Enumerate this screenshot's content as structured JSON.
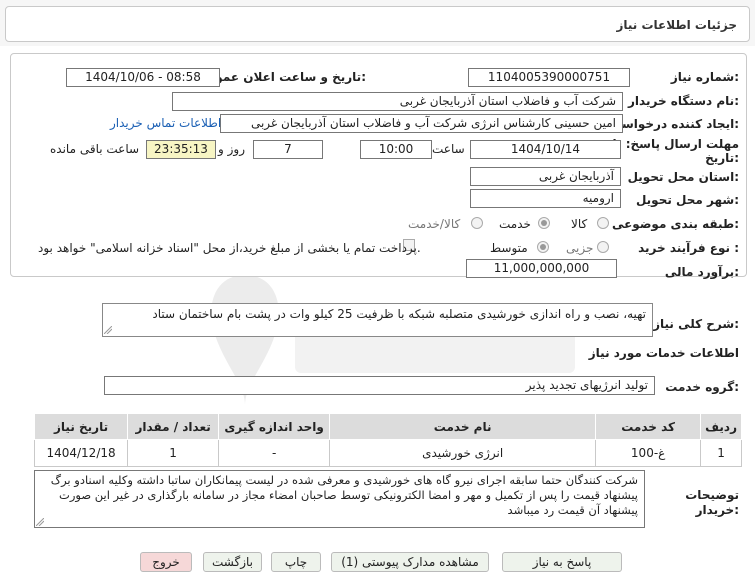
{
  "header": {
    "title": "جزئیات اطلاعات نیاز"
  },
  "form": {
    "need_number": {
      "label": "شماره نیاز:",
      "value": "1104005390000751"
    },
    "announce_datetime": {
      "label": "تاریخ و ساعت اعلان عمومی:",
      "value": "1404/10/06 - 08:58"
    },
    "buyer_org": {
      "label": "نام دستگاه خریدار:",
      "value": "شرکت آب و فاضلاب استان آذربایجان غربی"
    },
    "requester": {
      "label": "ایجاد کننده درخواست:",
      "value": "امین حسینی کارشناس انرژی شرکت آب و فاضلاب استان آذربایجان غربی"
    },
    "contact_link": "اطلاعات تماس خریدار",
    "deadline": {
      "label": "مهلت ارسال پاسخ: تا تاریخ:",
      "date": "1404/10/14",
      "time_label": "ساعت",
      "time": "10:00",
      "days": "7",
      "days_label": "روز و",
      "remaining": "23:35:13",
      "remaining_label": "ساعت باقی مانده"
    },
    "province": {
      "label": "استان محل تحویل:",
      "value": "آذربایجان غربی"
    },
    "city": {
      "label": "شهر محل تحویل:",
      "value": "ارومیه"
    },
    "category": {
      "label": "طبقه بندی موضوعی:",
      "options": [
        "کالا",
        "خدمت",
        "کالا/خدمت"
      ],
      "selected": "خدمت"
    },
    "process_type": {
      "label": "نوع فرآیند خرید :",
      "options": [
        "جزیی",
        "متوسط"
      ],
      "selected": "متوسط",
      "payment_note": "پرداخت تمام یا بخشی از مبلغ خرید،از محل \"اسناد خزانه اسلامی\" خواهد بود."
    },
    "estimate": {
      "label": "برآورد مالی:",
      "value": "11,000,000,000"
    }
  },
  "summary": {
    "label": "شرح کلی نیاز:",
    "value": "تهیه، نصب و راه اندازی خورشیدی متصلبه شبکه با ظرفیت 25 کیلو وات در پشت بام ساختمان ستاد"
  },
  "services": {
    "section_title": "اطلاعات خدمات مورد نیاز",
    "group_label": "گروه خدمت:",
    "group_value": "تولید انرژیهای تجدید پذیر",
    "columns": [
      "ردیف",
      "کد خدمت",
      "نام خدمت",
      "واحد اندازه گیری",
      "تعداد / مقدار",
      "تاریخ نیاز"
    ],
    "rows": [
      [
        "1",
        "غ-100",
        "انرژی خورشیدی",
        "-",
        "1",
        "1404/12/18"
      ]
    ]
  },
  "buyer_notes": {
    "label": "توضیحات خریدار:",
    "value": "شرکت کنندگان حتما سابقه اجرای نیرو گاه های خورشیدی و معرفی شده در لیست پیمانکاران ساتبا  داشته وکلیه اسنادو برگ پیشنهاد قیمت را پس از تکمیل و مهر و امضا الکترونیکی توسط صاحبان امضاء مجاز  در سامانه بارگذاری در غیر این صورت پیشنهاد آن قیمت رد میباشد"
  },
  "buttons": {
    "reply": "پاسخ به نیاز",
    "view_docs": "مشاهده مدارک پیوستی (1)",
    "print": "چاپ",
    "back": "بازگشت",
    "exit": "خروج"
  },
  "colors": {
    "link": "#1a5fb4",
    "remaining_bg": "#f7f5c4",
    "exit_bg": "#f6d8d8",
    "button_bg": "#eef3ec"
  }
}
